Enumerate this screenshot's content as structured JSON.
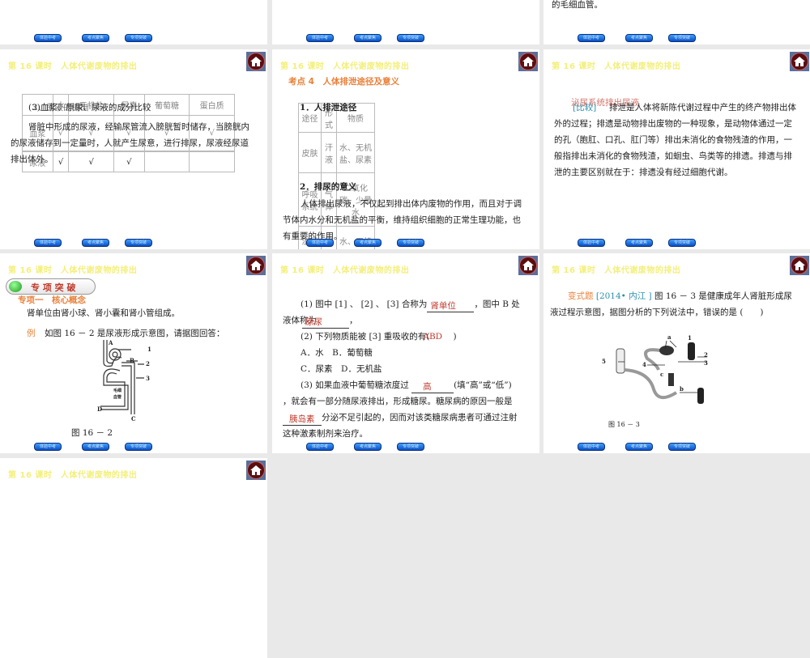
{
  "common": {
    "header_title": "第 16 课时　人体代谢废物的排出",
    "nav_buttons": [
      "体验中考",
      "考点聚焦",
      "专项突破"
    ],
    "home_icon": "home-icon"
  },
  "slide_top_right": {
    "text": "的毛细血管。"
  },
  "slide_compare": {
    "overlay_title": "(3)血浆、原尿、尿液的成分比较",
    "overlay_title2": "2．尿液的排出",
    "paragraph": "肾脏中形成的尿液，经输尿管流入膀胱暂时储存，当膀胱内的尿液储存到一定量时，人就产生尿意，进行排尿，尿液经尿道排出体外。",
    "table": {
      "headers": [
        "",
        "水",
        "无机盐",
        "尿素",
        "葡萄糖",
        "蛋白质"
      ],
      "rows": [
        [
          "血浆",
          "√",
          "√",
          "√",
          "√",
          "√"
        ],
        [
          "原尿",
          "√",
          "√",
          "√",
          "√",
          ""
        ],
        [
          "尿液",
          "√",
          "√",
          "√",
          "",
          ""
        ]
      ]
    }
  },
  "slide_excretion": {
    "section_title": "考点 4　人体排泄途径及意义",
    "sub1": "1．人排泄途径",
    "table": {
      "headers": [
        "途径",
        "形式",
        "物质"
      ],
      "rows": [
        [
          "皮肤",
          "汗液",
          "水、无机盐、尿素"
        ],
        [
          "呼吸系统",
          "气体",
          "二氧化碳、少量水"
        ],
        [
          "泌尿系统",
          "尿液",
          "水、无机盐、尿素"
        ]
      ]
    },
    "sub2": "2．排尿的意义",
    "paragraph": "人体排出尿液，不仅起到排出体内废物的作用，而且对于调节体内水分和无机盐的平衡，维持组织细胞的正常生理功能，也有重要的作用。"
  },
  "slide_compare2": {
    "red_text": "泌尿系统排出尿液",
    "tag": "[比较]",
    "paragraph": "排泄是人体将新陈代谢过程中产生的终产物排出体外的过程；排遗是动物排出废物的一种现象，是动物体通过一定的孔（胞肛、口孔、肛门等）排出未消化的食物残渣的作用，一般指排出未消化的食物残渣，如蛔虫、鸟类等的排遗。排遗与排泄的主要区别就在于：排遗没有经过细胞代谢。"
  },
  "slide_special": {
    "banner": "专 项 突 破",
    "topic": "专项一　核心概念",
    "statement": "肾单位由肾小球、肾小囊和肾小管组成。",
    "example_tag": "例",
    "example_text": "如图 16 － 2 是尿液形成示意图，请据图回答：",
    "figure_labels": [
      "A",
      "1",
      "B",
      "2",
      "3",
      "毛细",
      "血管",
      "D",
      "C"
    ],
    "caption": "图 16 － 2"
  },
  "slide_questions": {
    "q1a": "(1) 图中 [1] 、 [2] 、 [3] 合称为",
    "a1": "肾单位",
    "q1b": "，图中 B 处",
    "q1c": "液体称为",
    "a1b": "原尿",
    "q2": "(2) 下列物质能被 [3] 重吸收的有(",
    "a2": "ABD",
    "q2end": ")",
    "optAB": "A．水　B．葡萄糖",
    "optCD": "C．尿素　D．无机盐",
    "q3a": "(3) 如果血液中葡萄糖浓度过",
    "a3": "高",
    "q3b": "(填“高”或“低”)",
    "q3c": "，就会有一部分随尿液排出，形成糖尿。糖尿病的原因一般是",
    "a3b": "胰岛素",
    "q3d": "分泌不足引起的，因而对该类糖尿病患者可通过注射",
    "q3e": "这种激素制剂来治疗。"
  },
  "slide_variant": {
    "tag": "变式题",
    "source": "[2014• 内江 ]",
    "text1": "图 16 － 3 是健康成年人肾脏形成尿",
    "text2": "液过程示意图，据图分析的下列说法中，错误的是 (　　)",
    "figure_labels": [
      "a",
      "1",
      "2",
      "3",
      "4",
      "5",
      "b",
      "c"
    ],
    "caption": "图 16 － 3"
  }
}
